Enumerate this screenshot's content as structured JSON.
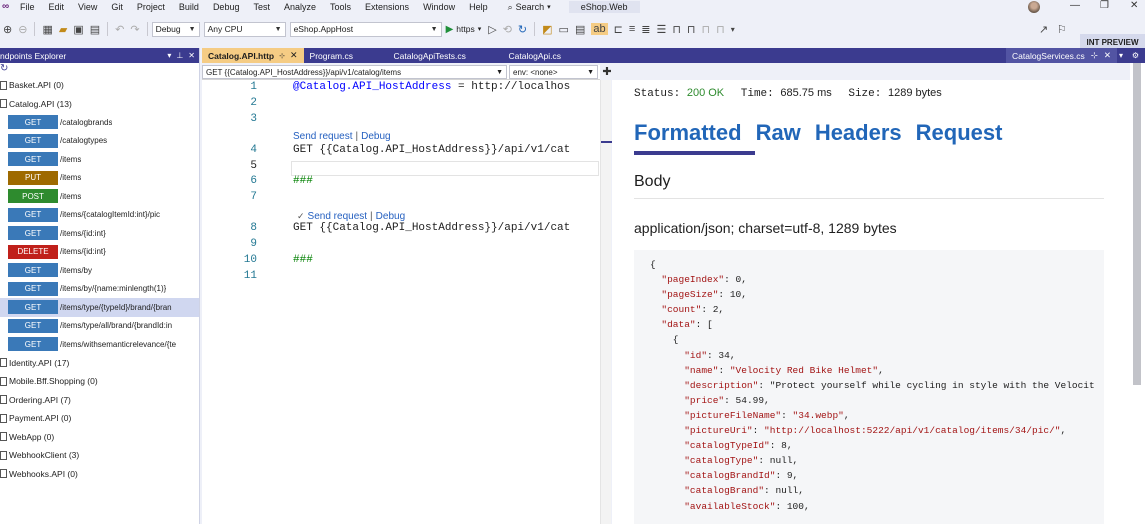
{
  "menubar": {
    "items": [
      "File",
      "Edit",
      "View",
      "Git",
      "Project",
      "Build",
      "Debug",
      "Test",
      "Analyze",
      "Tools",
      "Extensions",
      "Window",
      "Help"
    ],
    "search_label": "Search",
    "solution_name": "eShop.Web",
    "minimize": "—",
    "restore": "❐",
    "close": "✕"
  },
  "toolbar": {
    "config": "Debug",
    "platform": "Any CPU",
    "startup_project": "eShop.AppHost",
    "run_profile": "https",
    "int_preview": "INT PREVIEW"
  },
  "endpoints_panel": {
    "title": "ndpoints Explorer",
    "refresh": "↻",
    "projects": [
      {
        "name": "Basket.API (0)"
      },
      {
        "name": "Catalog.API (13)"
      }
    ],
    "endpoints": [
      {
        "method": "GET",
        "path": "/catalogbrands"
      },
      {
        "method": "GET",
        "path": "/catalogtypes"
      },
      {
        "method": "GET",
        "path": "/items"
      },
      {
        "method": "PUT",
        "path": "/items"
      },
      {
        "method": "POST",
        "path": "/items"
      },
      {
        "method": "GET",
        "path": "/items/{catalogItemId:int}/pic"
      },
      {
        "method": "GET",
        "path": "/items/{id:int}"
      },
      {
        "method": "DELETE",
        "path": "/items/{id:int}"
      },
      {
        "method": "GET",
        "path": "/items/by"
      },
      {
        "method": "GET",
        "path": "/items/by/{name:minlength(1)}"
      },
      {
        "method": "GET",
        "path": "/items/type/{typeId}/brand/{bran"
      },
      {
        "method": "GET",
        "path": "/items/type/all/brand/{brandId:in"
      },
      {
        "method": "GET",
        "path": "/items/withsemanticrelevance/{te"
      }
    ],
    "other_projects": [
      "Identity.API (17)",
      "Mobile.Bff.Shopping (0)",
      "Ordering.API (7)",
      "Payment.API (0)",
      "WebApp (0)",
      "WebhookClient (3)",
      "Webhooks.API (0)"
    ]
  },
  "editor_tabs": {
    "active": "Catalog.API.http",
    "others": [
      "Program.cs",
      "CatalogApiTests.cs",
      "CatalogApi.cs"
    ],
    "right_tab": "CatalogServices.cs"
  },
  "request_bar": {
    "request": "GET {{Catalog.API_HostAddress}}/api/v1/catalog/items",
    "env": "env: <none>"
  },
  "editor": {
    "line_numbers": [
      "1",
      "2",
      "3",
      "4",
      "5",
      "6",
      "7",
      "8",
      "9",
      "10",
      "11"
    ],
    "line1_var": "@Catalog.API_HostAddress",
    "line1_rest": " = http://localhos",
    "line4": "GET {{Catalog.API_HostAddress}}/api/v1/cat",
    "line6": "###",
    "line8": "GET {{Catalog.API_HostAddress}}/api/v1/cat",
    "line10": "###",
    "lens1_send": "Send request",
    "lens1_debug": "Debug",
    "lens2_check": "✓",
    "lens2_send": "Send request",
    "lens2_debug": "Debug",
    "lens_sep": "|"
  },
  "response": {
    "status_label": "Status:",
    "status_value": "200 OK",
    "time_label": "Time:",
    "time_value": "685.75 ms",
    "size_label": "Size:",
    "size_value": "1289 bytes",
    "tabs": [
      "Formatted",
      "Raw",
      "Headers",
      "Request"
    ],
    "body_heading": "Body",
    "content_type": "application/json; charset=utf-8, 1289 bytes",
    "json_lines": [
      "{",
      "  \"pageIndex\": 0,",
      "  \"pageSize\": 10,",
      "  \"count\": 2,",
      "  \"data\": [",
      "    {",
      "      \"id\": 34,",
      "      \"name\": \"Velocity Red Bike Helmet\",",
      "      \"description\": \"Protect yourself while cycling in style with the Velocit",
      "      \"price\": 54.99,",
      "      \"pictureFileName\": \"34.webp\",",
      "      \"pictureUri\": \"http://localhost:5222/api/v1/catalog/items/34/pic/\",",
      "      \"catalogTypeId\": 8,",
      "      \"catalogType\": null,",
      "      \"catalogBrandId\": 9,",
      "      \"catalogBrand\": null,",
      "      \"availableStock\": 100,"
    ]
  },
  "colors": {
    "accent": "#3b3b8f",
    "active_tab": "#f5cc84",
    "get": "#3a79b8",
    "put": "#9e6a00",
    "post": "#2e8b2e",
    "delete": "#c0201a",
    "link": "#2166b8"
  }
}
